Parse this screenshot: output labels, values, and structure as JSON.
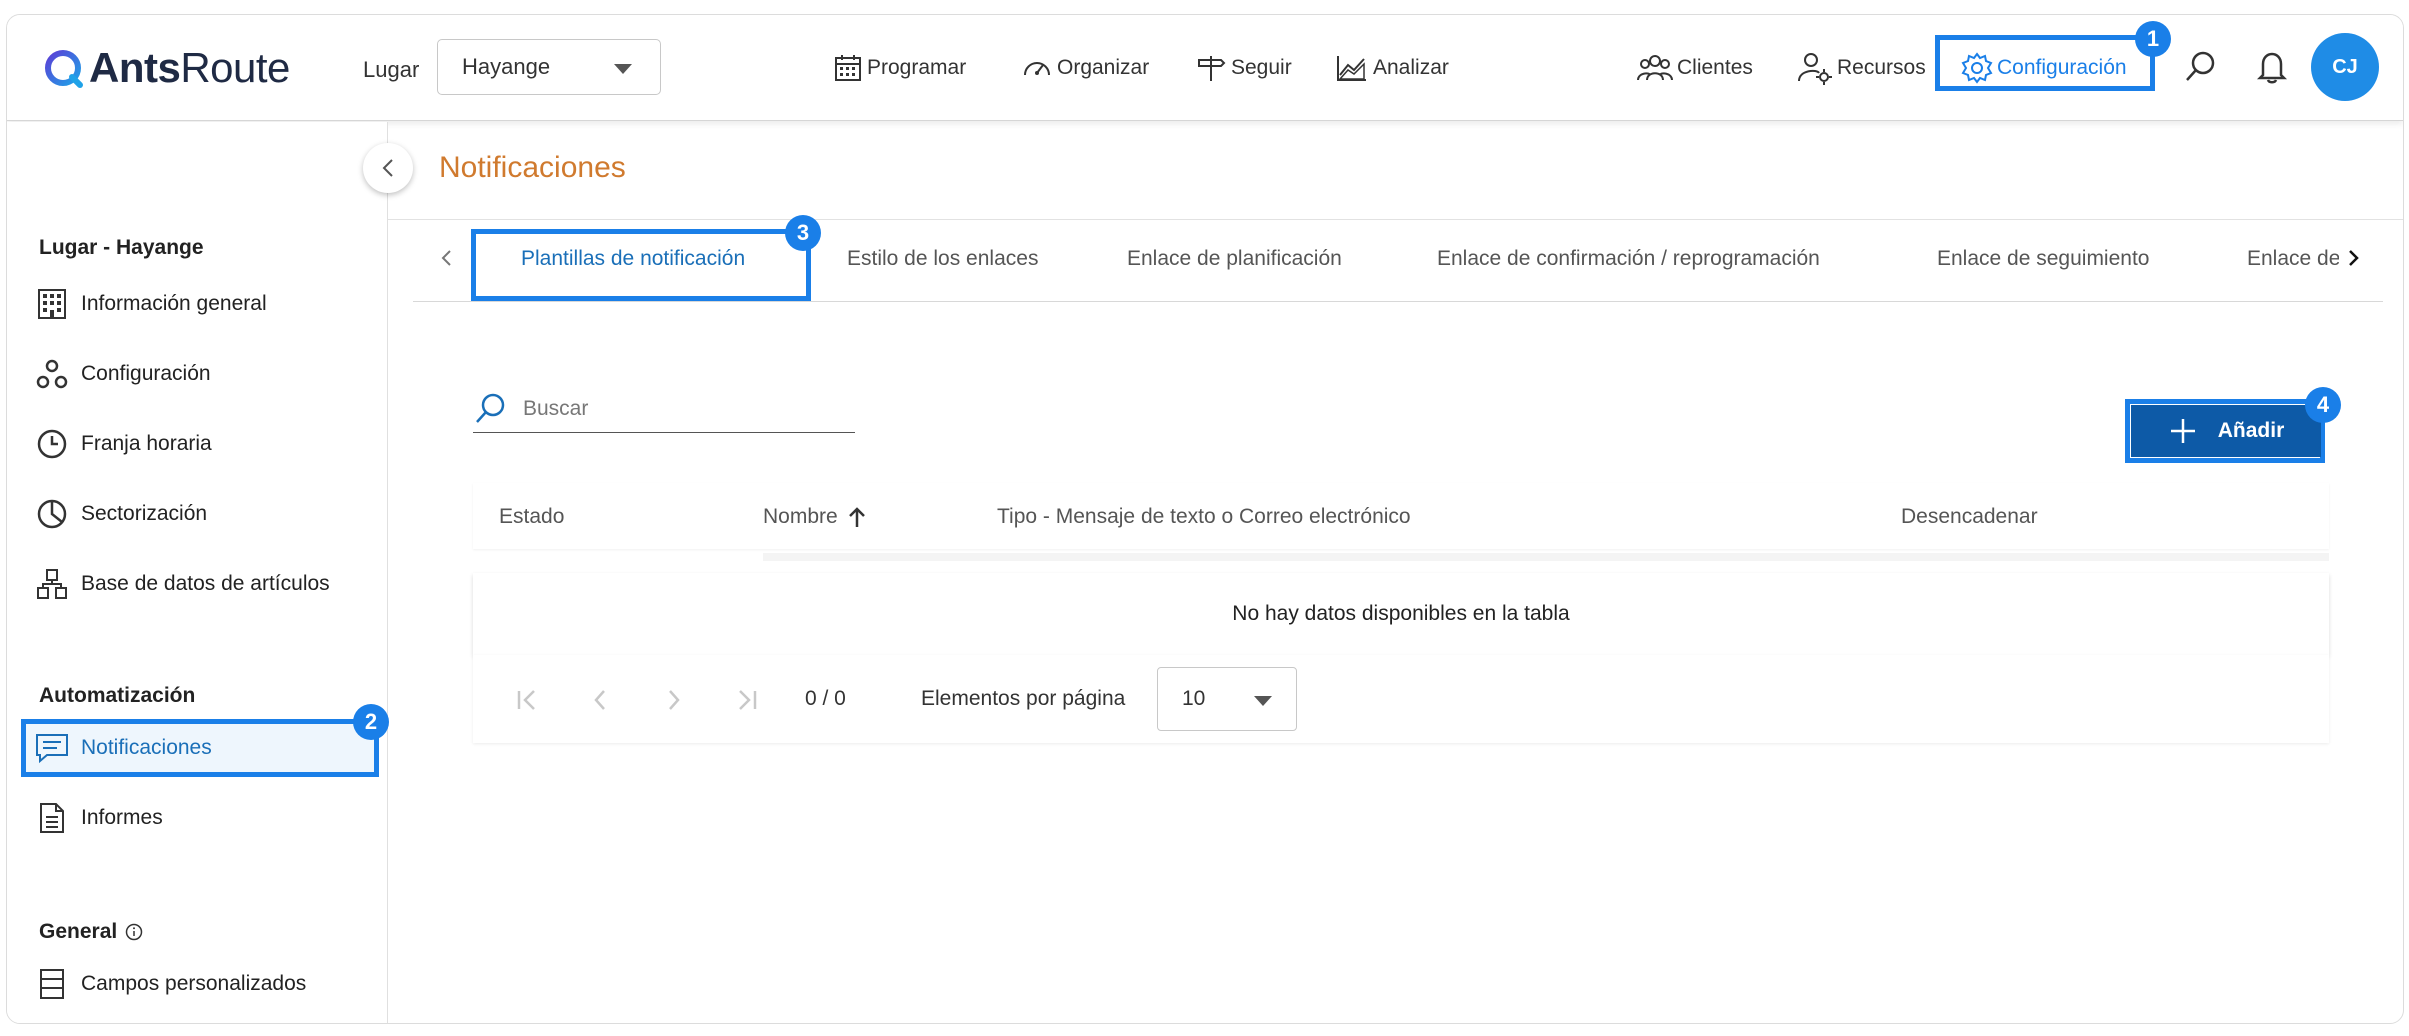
{
  "header": {
    "logo_bold": "Ants",
    "logo_light": "Route",
    "lugar_label": "Lugar",
    "lugar_value": "Hayange",
    "nav": [
      {
        "label": "Programar",
        "icon": "calendar-icon"
      },
      {
        "label": "Organizar",
        "icon": "gauge-icon"
      },
      {
        "label": "Seguir",
        "icon": "signpost-icon"
      },
      {
        "label": "Analizar",
        "icon": "chart-icon"
      }
    ],
    "right_nav": [
      {
        "label": "Clientes",
        "icon": "users-icon"
      },
      {
        "label": "Recursos",
        "icon": "user-gear-icon"
      },
      {
        "label": "Configuración",
        "icon": "gear-icon"
      }
    ],
    "avatar_initials": "CJ",
    "accent_color": "#1a7fe8"
  },
  "sidebar": {
    "section1": "Lugar - Hayange",
    "items1": [
      {
        "label": "Información general",
        "icon": "building-icon"
      },
      {
        "label": "Configuración",
        "icon": "cogs-icon"
      },
      {
        "label": "Franja horaria",
        "icon": "clock-icon"
      },
      {
        "label": "Sectorización",
        "icon": "pie-icon"
      },
      {
        "label": "Base de datos de artículos",
        "icon": "boxes-icon"
      }
    ],
    "section2": "Automatización",
    "items2": [
      {
        "label": "Notificaciones",
        "icon": "chat-icon"
      },
      {
        "label": "Informes",
        "icon": "document-icon"
      }
    ],
    "section3": "General",
    "items3": [
      {
        "label": "Campos personalizados",
        "icon": "table-icon"
      }
    ]
  },
  "main": {
    "title": "Notificaciones",
    "tabs": [
      "Plantillas de notificación",
      "Estilo de los enlaces",
      "Enlace de planificación",
      "Enlace de confirmación / reprogramación",
      "Enlace de seguimiento",
      "Enlace de"
    ],
    "search_placeholder": "Buscar",
    "add_label": "Añadir",
    "columns": [
      "Estado",
      "Nombre",
      "Tipo - Mensaje de texto o Correo electrónico",
      "Desencadenar"
    ],
    "empty_message": "No hay datos disponibles en la tabla",
    "page_count": "0 / 0",
    "per_page_label": "Elementos por página",
    "per_page_value": "10"
  },
  "annotations": [
    "1",
    "2",
    "3",
    "4"
  ]
}
